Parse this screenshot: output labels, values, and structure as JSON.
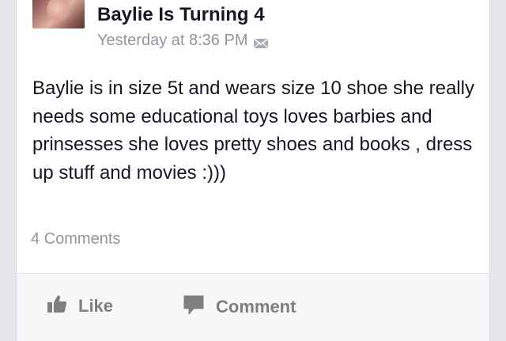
{
  "post": {
    "author": "Baylie Is Turning 4",
    "timestamp": "Yesterday at 8:36 PM",
    "privacy_icon": "envelope-icon",
    "text": "Baylie is in size 5t and wears size 10 shoe she really needs some educational toys loves barbies and prinsesses she loves pretty shoes and books , dress up stuff and movies :)))",
    "comments_count": "4 Comments"
  },
  "actions": {
    "like_label": "Like",
    "like_icon": "thumbs-up-icon",
    "comment_label": "Comment",
    "comment_icon": "speech-bubble-icon"
  },
  "colors": {
    "page_background": "#e6e7ec",
    "card_background": "#ffffff",
    "primary_text": "#141823",
    "secondary_text": "#90949c",
    "action_text": "#7f7f7f",
    "action_bar_background": "#f6f7f9"
  }
}
